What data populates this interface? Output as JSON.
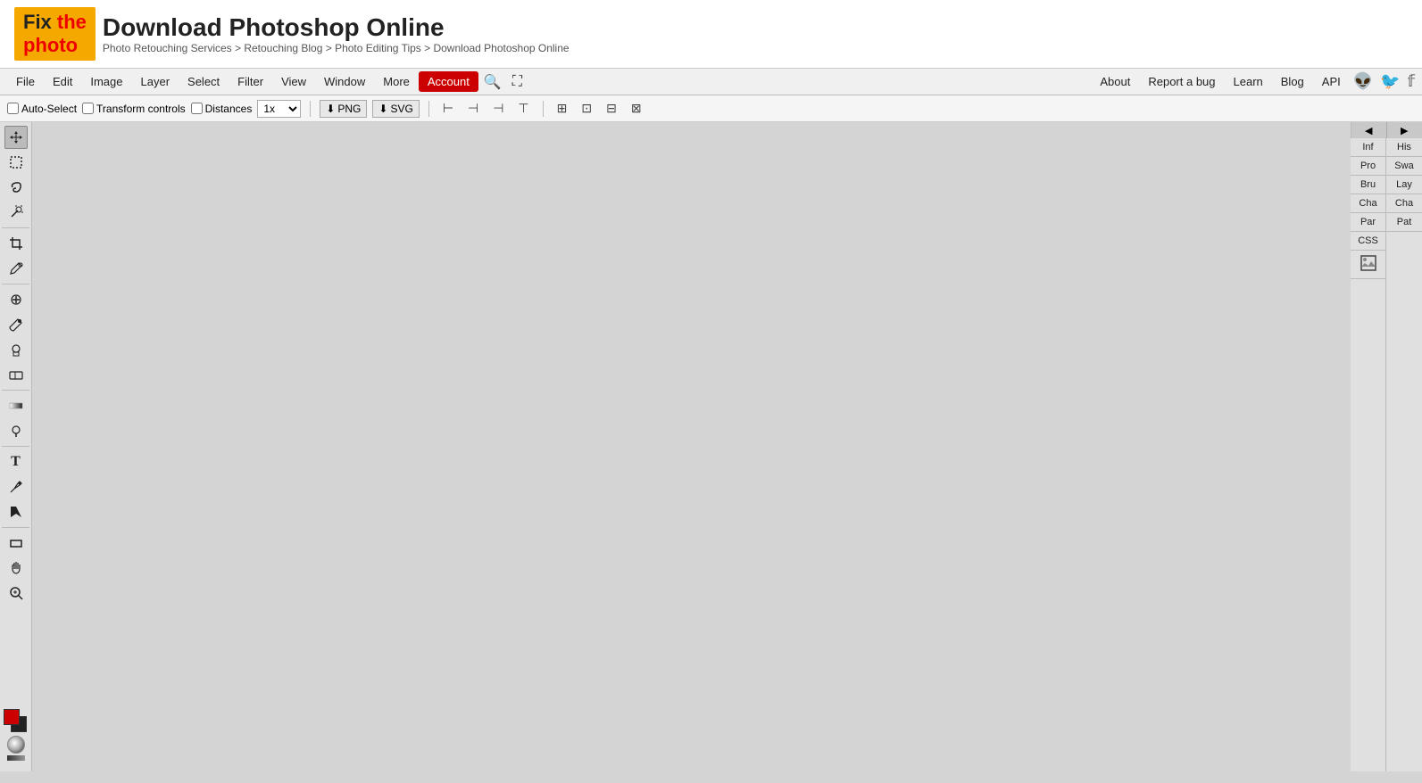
{
  "header": {
    "logo_bold": "Fix",
    "logo_sub": "the photo",
    "title": "Download Photoshop Online",
    "breadcrumb": "Photo Retouching Services > Retouching Blog > Photo Editing Tips > Download Photoshop Online"
  },
  "menubar": {
    "items": [
      "File",
      "Edit",
      "Image",
      "Layer",
      "Select",
      "Filter",
      "View",
      "Window",
      "More",
      "Account"
    ],
    "active_item": "Account",
    "right_links": [
      "About",
      "Report a bug",
      "Learn",
      "Blog",
      "API"
    ],
    "social": [
      "reddit",
      "twitter",
      "facebook"
    ]
  },
  "toolbar": {
    "auto_select_label": "Auto-Select",
    "transform_controls_label": "Transform controls",
    "distances_label": "Distances",
    "zoom_value": "1x",
    "png_label": "PNG",
    "svg_label": "SVG"
  },
  "left_tools": [
    {
      "name": "move-tool",
      "icon": "⊹",
      "label": "Move Tool"
    },
    {
      "name": "selection-tool",
      "icon": "⬚",
      "label": "Rectangular Marquee"
    },
    {
      "name": "lasso-tool",
      "icon": "⌒",
      "label": "Lasso"
    },
    {
      "name": "magic-wand-tool",
      "icon": "✳",
      "label": "Magic Wand"
    },
    {
      "name": "crop-tool",
      "icon": "⊡",
      "label": "Crop"
    },
    {
      "name": "eyedropper-tool",
      "icon": "✏",
      "label": "Eyedropper"
    },
    {
      "name": "heal-tool",
      "icon": "⊕",
      "label": "Healing Brush"
    },
    {
      "name": "brush-tool",
      "icon": "✒",
      "label": "Brush"
    },
    {
      "name": "stamp-tool",
      "icon": "⊙",
      "label": "Clone Stamp"
    },
    {
      "name": "eraser-tool",
      "icon": "◻",
      "label": "Eraser"
    },
    {
      "name": "gradient-tool",
      "icon": "▭",
      "label": "Gradient"
    },
    {
      "name": "dodge-tool",
      "icon": "◎",
      "label": "Dodge"
    },
    {
      "name": "text-tool",
      "icon": "T",
      "label": "Type"
    },
    {
      "name": "pen-tool",
      "icon": "✎",
      "label": "Pen"
    },
    {
      "name": "path-select-tool",
      "icon": "↖",
      "label": "Path Selection"
    },
    {
      "name": "shape-tool",
      "icon": "▬",
      "label": "Shape"
    },
    {
      "name": "hand-tool",
      "icon": "✋",
      "label": "Hand"
    },
    {
      "name": "zoom-tool",
      "icon": "🔍",
      "label": "Zoom"
    }
  ],
  "right_panels": {
    "col1": [
      "Inf",
      "Pro",
      "Bru",
      "Cha",
      "Par",
      "CSS",
      "img"
    ],
    "col2": [
      "His",
      "Swa",
      "Lay",
      "Cha",
      "Pat"
    ]
  },
  "canvas": {
    "background": "#d4d4d4"
  }
}
